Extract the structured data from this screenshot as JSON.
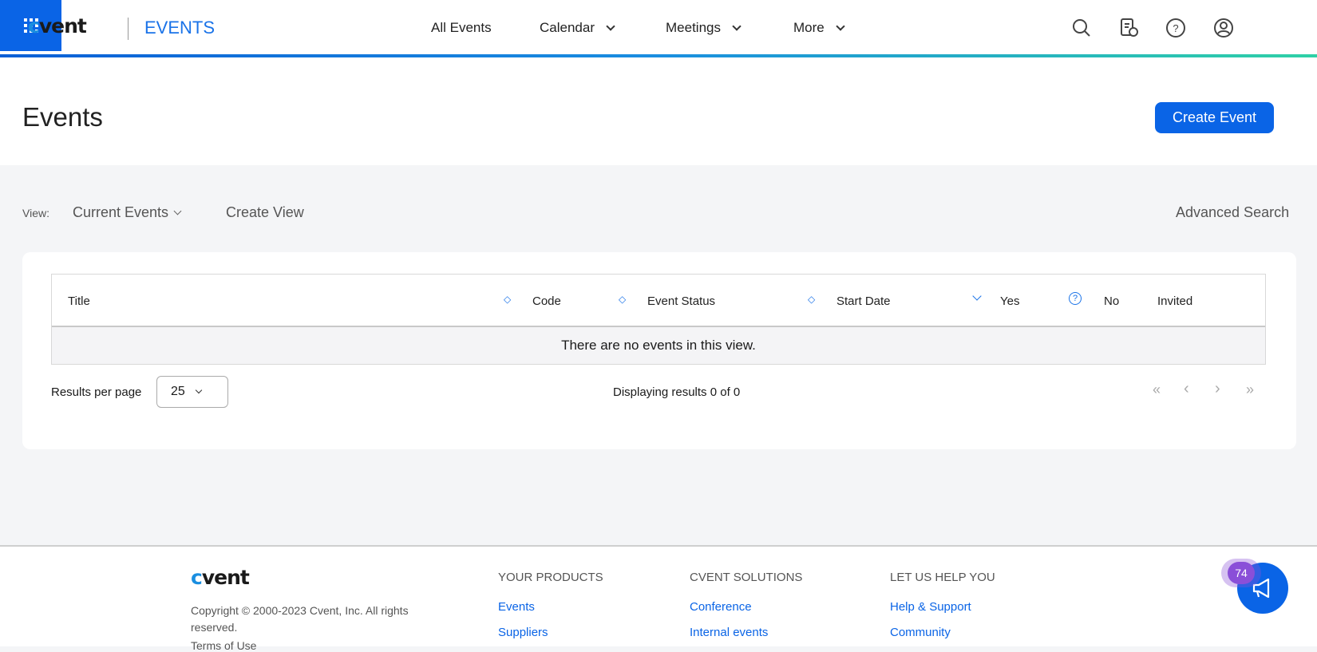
{
  "header": {
    "logo": "cvent",
    "product": "EVENTS",
    "nav": [
      {
        "label": "All Events"
      },
      {
        "label": "Calendar"
      },
      {
        "label": "Meetings"
      },
      {
        "label": "More"
      }
    ],
    "icons": [
      "search-icon",
      "report-clock-icon",
      "help-icon",
      "user-icon",
      "app-grid-icon"
    ]
  },
  "page": {
    "title": "Events",
    "create_button": "Create Event"
  },
  "toolbar": {
    "view_label": "View:",
    "view_value": "Current Events",
    "create_view": "Create View",
    "advanced_search": "Advanced Search"
  },
  "table": {
    "columns": [
      "Title",
      "Code",
      "Event Status",
      "Start Date",
      "Yes",
      "No",
      "Invited"
    ],
    "empty_message": "There are no events in this view."
  },
  "pagination": {
    "results_label": "Results per page",
    "per_page": "25",
    "displaying": "Displaying results 0 of 0"
  },
  "footer": {
    "logo": "cvent",
    "copyright": "Copyright © 2000-2023 Cvent, Inc. All rights reserved.",
    "terms": "Terms of Use",
    "columns": [
      {
        "heading": "YOUR PRODUCTS",
        "links": [
          "Events",
          "Suppliers"
        ]
      },
      {
        "heading": "CVENT SOLUTIONS",
        "links": [
          "Conference",
          "Internal events"
        ]
      },
      {
        "heading": "LET US HELP YOU",
        "links": [
          "Help & Support",
          "Community"
        ]
      }
    ]
  },
  "chat": {
    "badge": "74"
  },
  "colors": {
    "brand": "#0a64e6",
    "accent": "#1a8ee0",
    "badge": "#8a4fd8"
  }
}
